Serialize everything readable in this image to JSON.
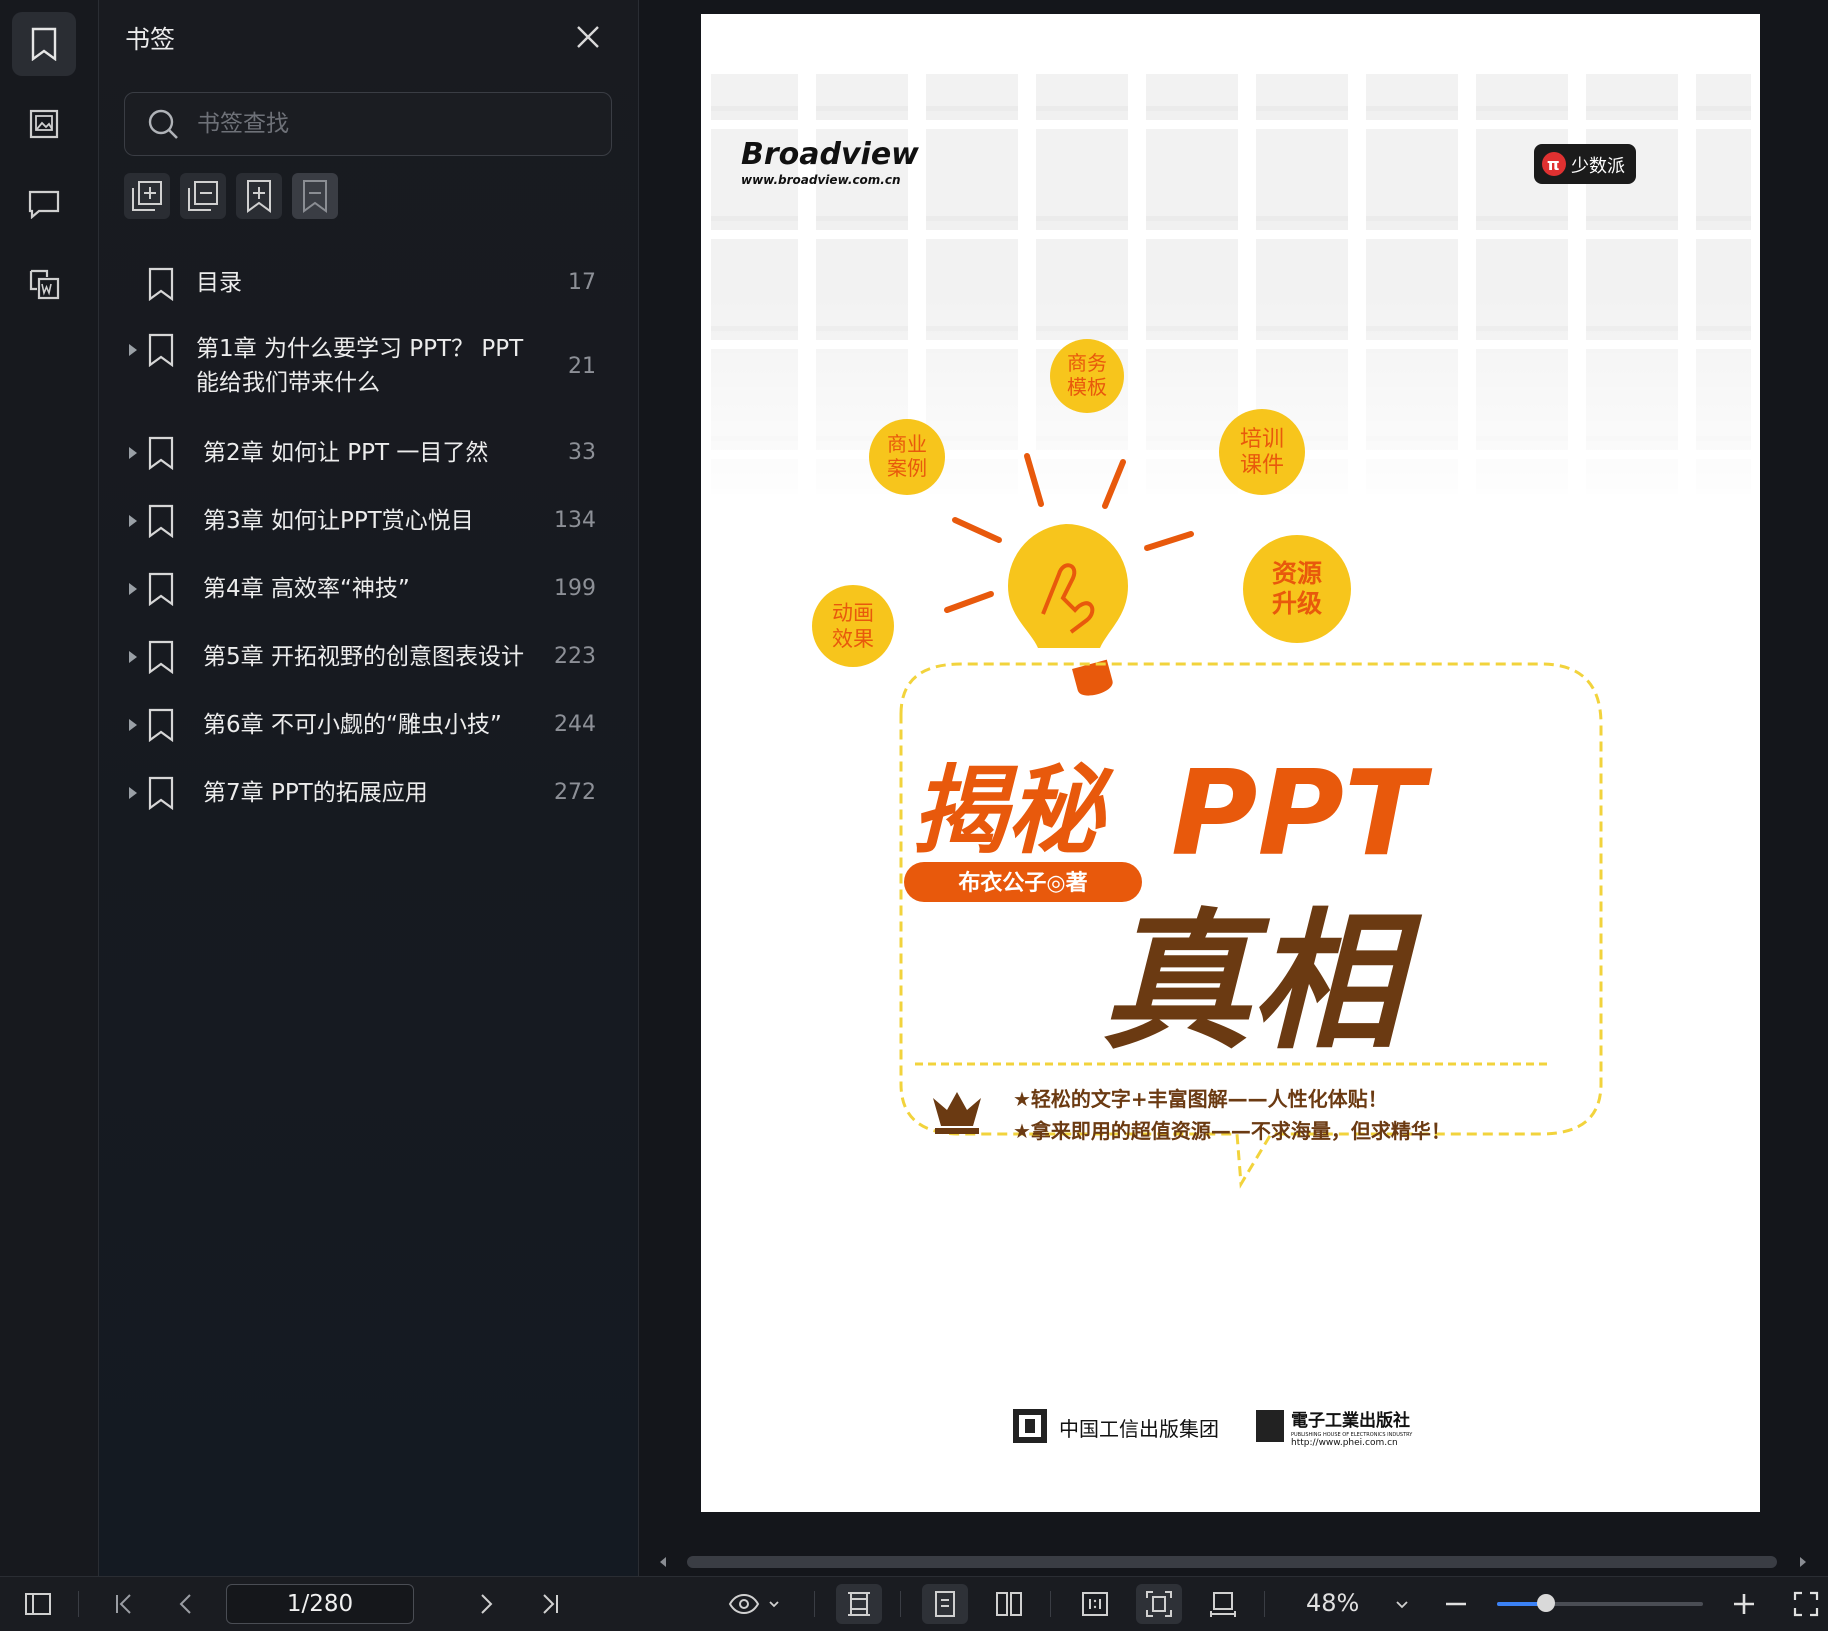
{
  "sidebar": {
    "title": "书签",
    "search_placeholder": "书签查找",
    "bookmarks": [
      {
        "label": "目录",
        "label2": "",
        "page": "17",
        "expandable": false
      },
      {
        "label": "第1章 为什么要学习 PPT？ PPT",
        "label2": "能给我们带来什么",
        "page": "21",
        "expandable": true
      },
      {
        "label": "第2章 如何让 PPT 一目了然",
        "label2": "",
        "page": "33",
        "expandable": true
      },
      {
        "label": "第3章 如何让PPT赏心悦目",
        "label2": "",
        "page": "134",
        "expandable": true
      },
      {
        "label": "第4章 高效率“神技”",
        "label2": "",
        "page": "199",
        "expandable": true
      },
      {
        "label": "第5章 开拓视野的创意图表设计",
        "label2": "",
        "page": "223",
        "expandable": true
      },
      {
        "label": "第6章 不可小觑的“雕虫小技”",
        "label2": "",
        "page": "244",
        "expandable": true
      },
      {
        "label": "第7章 PPT的拓展应用",
        "label2": "",
        "page": "272",
        "expandable": true
      }
    ]
  },
  "cover": {
    "publisher_logo": "Broadview",
    "publisher_url": "www.broadview.com.cn",
    "series_badge": "少数派",
    "bubbles": [
      {
        "l1": "商务",
        "l2": "模板"
      },
      {
        "l1": "商业",
        "l2": "案例"
      },
      {
        "l1": "培训",
        "l2": "课件"
      },
      {
        "l1": "资源",
        "l2": "升级"
      },
      {
        "l1": "动画",
        "l2": "效果"
      }
    ],
    "title_part1": "揭秘",
    "title_part2": "PPT",
    "title_part3": "真相",
    "author": "布衣公子◎著",
    "tagline1": "★轻松的文字+丰富图解——人性化体贴！",
    "tagline2": "★拿来即用的超值资源——不求海量，但求精华！",
    "imprint1": "中国工信出版集团",
    "imprint2": "電子工業出版社",
    "imprint2_en": "PUBLISHING HOUSE OF ELECTRONICS INDUSTRY",
    "imprint2_url": "http://www.phei.com.cn"
  },
  "toolbar": {
    "page_indicator": "1/280",
    "zoom": "48%",
    "zoom_fraction": 0.24
  },
  "colors": {
    "accent": "#3b82f6",
    "cover_orange": "#e8590c",
    "cover_brown": "#6b3a12",
    "cover_yellow": "#f7c51c"
  }
}
